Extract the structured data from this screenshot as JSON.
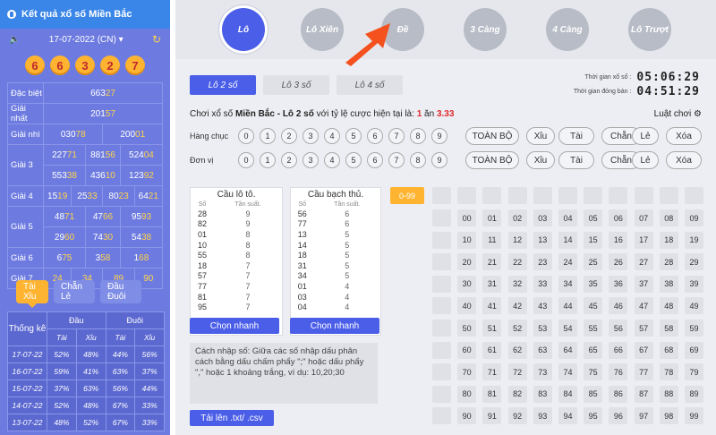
{
  "left": {
    "title": "Kết quả xổ số Miền Bắc",
    "date": "17-07-2022 (CN)",
    "balls": [
      "6",
      "6",
      "3",
      "2",
      "7"
    ],
    "results": [
      {
        "label": "Đặc biệt",
        "rows": [
          [
            "663",
            "27"
          ]
        ]
      },
      {
        "label": "Giải nhất",
        "rows": [
          [
            "201",
            "57"
          ]
        ]
      },
      {
        "label": "Giải nhì",
        "rows": [
          [
            "030",
            "78"
          ],
          [
            "200",
            "01"
          ]
        ]
      },
      {
        "label": "Giải 3",
        "rows": [
          [
            "227",
            "71"
          ],
          [
            "881",
            "56"
          ],
          [
            "524",
            "04"
          ],
          [
            "553",
            "38"
          ],
          [
            "436",
            "10"
          ],
          [
            "123",
            "92"
          ]
        ]
      },
      {
        "label": "Giải 4",
        "rows": [
          [
            "15",
            "19"
          ],
          [
            "25",
            "33"
          ],
          [
            "80",
            "23"
          ],
          [
            "64",
            "21"
          ]
        ]
      },
      {
        "label": "Giải 5",
        "rows": [
          [
            "48",
            "71"
          ],
          [
            "47",
            "66"
          ],
          [
            "95",
            "93"
          ],
          [
            "29",
            "60"
          ],
          [
            "74",
            "30"
          ],
          [
            "54",
            "38"
          ]
        ]
      },
      {
        "label": "Giải 6",
        "rows": [
          [
            "6",
            "75"
          ],
          [
            "3",
            "58"
          ],
          [
            "1",
            "68"
          ]
        ]
      },
      {
        "label": "Giải 7",
        "rows": [
          [
            "",
            "24"
          ],
          [
            "",
            "34"
          ],
          [
            "",
            "89"
          ],
          [
            "",
            "90"
          ]
        ]
      }
    ],
    "tabs": [
      "Tài Xỉu",
      "Chẵn Lẻ",
      "Đầu Đuôi"
    ],
    "stats": {
      "head_label": "Thống kê",
      "dau": "Đầu",
      "duoi": "Đuôi",
      "tai": "Tài",
      "xiu": "Xỉu",
      "rows": [
        [
          "17-07-22",
          "52%",
          "48%",
          "44%",
          "56%"
        ],
        [
          "16-07-22",
          "59%",
          "41%",
          "63%",
          "37%"
        ],
        [
          "15-07-22",
          "37%",
          "63%",
          "56%",
          "44%"
        ],
        [
          "14-07-22",
          "52%",
          "48%",
          "67%",
          "33%"
        ],
        [
          "13-07-22",
          "48%",
          "52%",
          "67%",
          "33%"
        ]
      ]
    }
  },
  "nav": [
    "Lô",
    "Lô Xiên",
    "Đề",
    "3 Càng",
    "4 Càng",
    "Lô Trượt"
  ],
  "subtabs": [
    "Lô 2 số",
    "Lô 3 số",
    "Lô 4 số"
  ],
  "timers": [
    {
      "label": "Thời gian xổ số :",
      "value": "05:06:29"
    },
    {
      "label": "Thời gian đóng bàn :",
      "value": "04:51:29"
    }
  ],
  "rule": {
    "prefix": "Chơi xổ số ",
    "region": "Miền Bắc - Lô 2 số",
    "mid": " với tỷ lệ cược hiện tại là: ",
    "one": "1",
    "an": " ăn ",
    "rate": "3.33"
  },
  "luat": "Luật chơi",
  "hang_chuc": "Hàng chục",
  "don_vi": "Đơn vị",
  "digits": [
    "0",
    "1",
    "2",
    "3",
    "4",
    "5",
    "6",
    "7",
    "8",
    "9"
  ],
  "filters": [
    "TOÀN BỘ",
    "Xỉu",
    "Tài",
    "Chẵn",
    "Lẻ",
    "Xóa"
  ],
  "cau_lo": {
    "title": "Cầu lô tô.",
    "col1": "Số",
    "col2": "Tần suất.",
    "rows": [
      [
        "28",
        "9"
      ],
      [
        "82",
        "9"
      ],
      [
        "01",
        "8"
      ],
      [
        "10",
        "8"
      ],
      [
        "55",
        "8"
      ],
      [
        "18",
        "7"
      ],
      [
        "57",
        "7"
      ],
      [
        "77",
        "7"
      ],
      [
        "81",
        "7"
      ],
      [
        "95",
        "7"
      ]
    ]
  },
  "cau_bach": {
    "title": "Cầu bạch thủ.",
    "col1": "Số",
    "col2": "Tần suất.",
    "rows": [
      [
        "56",
        "6"
      ],
      [
        "77",
        "6"
      ],
      [
        "13",
        "5"
      ],
      [
        "14",
        "5"
      ],
      [
        "18",
        "5"
      ],
      [
        "31",
        "5"
      ],
      [
        "34",
        "5"
      ],
      [
        "01",
        "4"
      ],
      [
        "03",
        "4"
      ],
      [
        "04",
        "4"
      ]
    ]
  },
  "chon_nhanh": "Chọn nhanh",
  "help": "Cách nhập số: Giữa các số nhập dấu phân cách bằng dấu chấm phẩy \";\" hoặc dấu phẩy \",\" hoặc 1 khoảng trắng, ví dụ: 10,20;30",
  "upload": "Tải lên .txt/ .csv",
  "range": "0-99"
}
